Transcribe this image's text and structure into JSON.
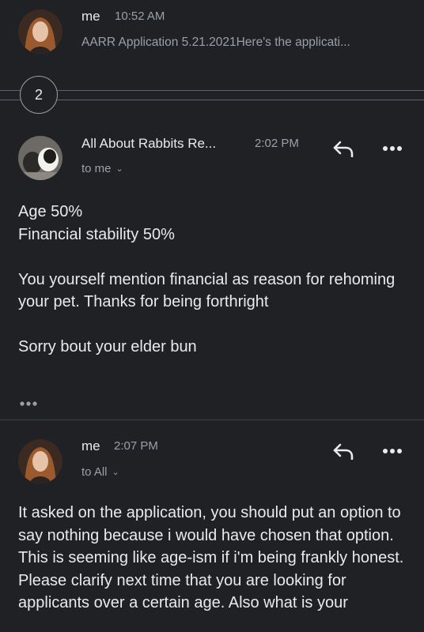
{
  "thread": {
    "collapsed": {
      "sender": "me",
      "time": "10:52 AM",
      "snippet": "AARR Application 5.21.2021Here's the applicati..."
    },
    "hidden_count": "2",
    "message1": {
      "sender": "All About Rabbits Re...",
      "time": "2:02 PM",
      "recipient": "to me",
      "body_lines": [
        "Age 50%",
        "Financial stability 50%"
      ],
      "body_para2": "You yourself mention financial as reason for rehoming your pet. Thanks for being forthright",
      "body_para3": "Sorry bout your elder bun"
    },
    "message2": {
      "sender": "me",
      "time": "2:07 PM",
      "recipient": "to All",
      "body": "It asked on the application, you should put an option to say nothing because i would have chosen that option. This is seeming like age-ism if i'm being frankly honest. Please clarify next time that you are looking for applicants over a certain age. Also what is your"
    }
  },
  "icons": {
    "reply": "reply-icon",
    "more": "more-horizontal-icon",
    "quoted": "show-trimmed-content-icon",
    "chevron": "chevron-down-icon"
  },
  "colors": {
    "background": "#202124",
    "primary_text": "#e8eaed",
    "secondary_text": "#9aa0a6",
    "divider": "#5f6368"
  }
}
